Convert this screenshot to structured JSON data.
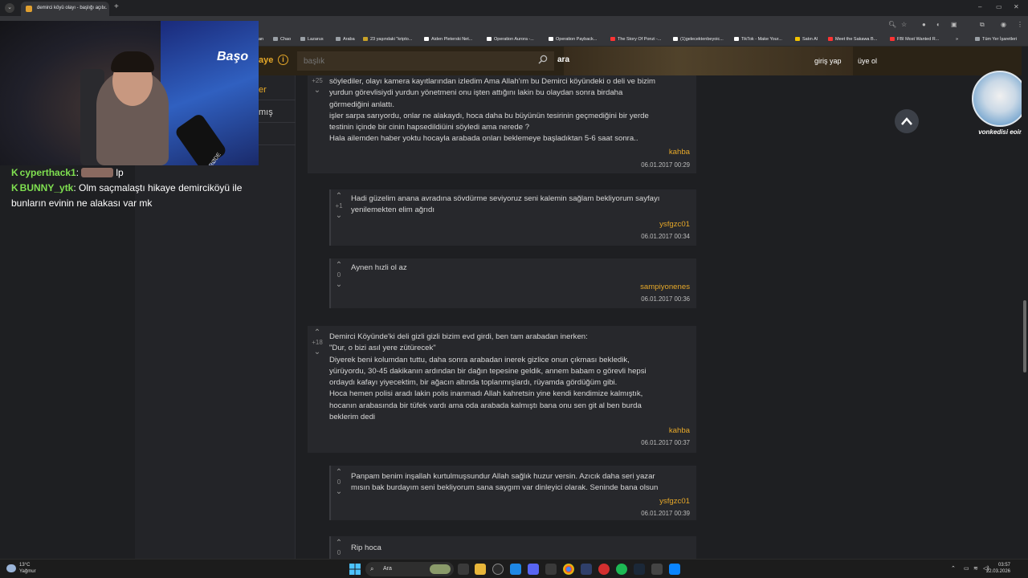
{
  "browser": {
    "tab_title": "demirci köyü olayı - başlığı açıl...",
    "new_tab": "+",
    "close_tab": "×",
    "window_controls": [
      "–",
      "▭",
      "✕"
    ]
  },
  "bookmarks": [
    {
      "label": "an",
      "color": "#e8eaed"
    },
    {
      "label": "Chao",
      "color": "#9aa0a6"
    },
    {
      "label": "Lazarus",
      "color": "#9aa0a6"
    },
    {
      "label": "Araba",
      "color": "#9aa0a6"
    },
    {
      "label": "23 yaşındaki \"kripto...",
      "color": "#c9a227"
    },
    {
      "label": "Aiden Pleterski Net...",
      "color": "#ffffff"
    },
    {
      "label": "Operation Aurora -...",
      "color": "#ffffff"
    },
    {
      "label": "Operation Payback...",
      "color": "#ffffff"
    },
    {
      "label": "The Story Of Ponzi -...",
      "color": "#ff3333"
    },
    {
      "label": "(1)gelecektenbeyoic...",
      "color": "#ffffff"
    },
    {
      "label": "TikTok - Make Your...",
      "color": "#ffffff"
    },
    {
      "label": "Satın Al",
      "color": "#f2c200"
    },
    {
      "label": "Meet the Sakawa B...",
      "color": "#ff3333"
    },
    {
      "label": "FBI Most Wanted R...",
      "color": "#ff3333"
    },
    {
      "label": "Tüm Yer İşaretleri",
      "color": "#9aa0a6"
    }
  ],
  "site": {
    "logo_fragment": "aye",
    "search_placeholder": "başlık",
    "search_button": "ara",
    "login": "giriş yap",
    "register": "üye ol",
    "accent_color": "#e6a829"
  },
  "sidebar": {
    "items": [
      {
        "label": "er"
      },
      {
        "label": "mış"
      }
    ]
  },
  "overlay": {
    "cam_logo": "Başo",
    "mic_brand": "RØDE",
    "chat": [
      {
        "user": "cyperthack1",
        "message": "lp"
      },
      {
        "user": "BUNNY_ytk",
        "message": "Olm saçmalaştı hikaye demirciköyü ile bunların evinin ne alakası var mk"
      }
    ]
  },
  "entries": [
    {
      "votes": "+25",
      "text": "söylediler, olayı kamera kayıtlarından izledim Ama Allah'ım bu Demirci köyündeki o deli ve bizim\nyurdun görevlisiydi yurdun yönetmeni onu işten attığını lakin bu olaydan sonra birdaha\ngörmediğini anlattı.\nişler sarpa sarıyordu, onlar ne alakaydı, hoca daha bu büyünün tesirinin geçmediğini bir yerde\ntestinin içinde bir cinin hapsedildiüini söyledi ama nerede ?\nHala ailemden haber yoktu hocayla arabada onları beklemeye başladıktan 5-6 saat sonra..",
      "author": "kahba",
      "date": "06.01.2017 00:29"
    },
    {
      "votes": "+1",
      "text": "Hadi güzelim anana avradına sövdürme seviyoruz seni kalemin sağlam bekliyorum sayfayı\nyenilemekten elim ağrıdı",
      "author": "ysfgzc01",
      "date": "06.01.2017 00:34"
    },
    {
      "votes": "0",
      "text": "Aynen hızli ol az",
      "author": "sampiyonenes",
      "date": "06.01.2017 00:36"
    },
    {
      "votes": "+18",
      "text": "Demirci Köyünde'ki deli gizli gizli bizim evd girdi, ben tam arabadan inerken:\n\"Dur, o bizi asıl yere zütürecek\"\nDiyerek beni kolumdan tuttu, daha sonra arabadan inerek gizlice onun çıkması bekledik,\nyürüyordu, 30-45 dakikanın ardından bir dağın tepesine geldik, annem babam o görevli hepsi\nordaydı kafayı yiyecektim, bir ağacın altında toplanmışlardı, rüyamda gördüğüm gibi.\nHoca hemen polisi aradı lakin polis inanmadı Allah kahretsin yine kendi kendimize kalmıştık,\nhocanın arabasında bir tüfek vardı ama oda arabada kalmıştı bana onu sen git al ben burda\nbeklerim dedi",
      "author": "kahba",
      "date": "06.01.2017 00:37"
    },
    {
      "votes": "0",
      "text": "Panpam benim inşallah kurtulmuşsundur Allah sağlık huzur versin. Azıcık daha seri yazar\nmısın bak burdayım seni bekliyorum sana saygım var dinleyici olarak. Seninde bana olsun",
      "author": "ysfgzc01",
      "date": "06.01.2017 00:39"
    },
    {
      "votes": "0",
      "text": "Rip hoca",
      "author": "",
      "date": ""
    }
  ],
  "avatar_caption": "vonkedisi eoin",
  "taskbar": {
    "weather_temp": "13°C",
    "weather_desc": "Yağmur",
    "search_label": "Ara",
    "time": "03:57",
    "date": "22.03.2026"
  }
}
